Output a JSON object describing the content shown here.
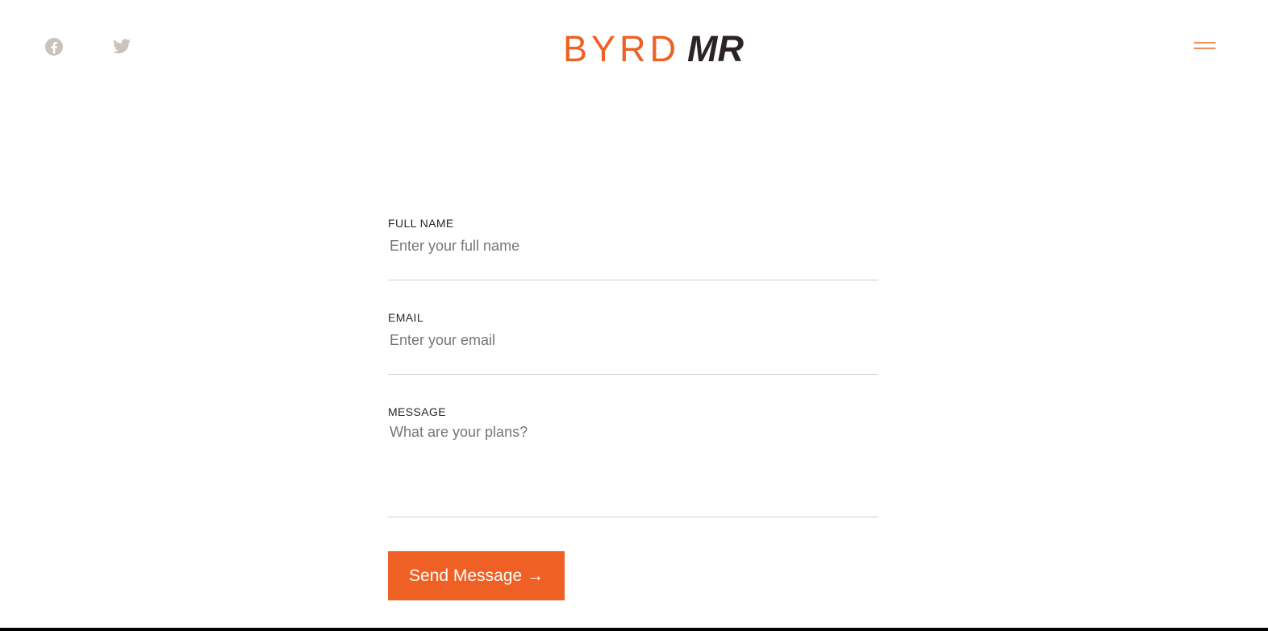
{
  "header": {
    "social": [
      {
        "icon": "facebook-icon",
        "color": "#c9c2bd"
      },
      {
        "icon": "twitter-icon",
        "color": "#c9c2bd"
      }
    ],
    "logo": {
      "part1": "BYRD",
      "part2": "MR",
      "part1_color": "#ee6023",
      "part2_color": "#2b2424"
    },
    "menu": {
      "icon": "hamburger-menu-icon",
      "color": "#ef8f59"
    }
  },
  "form": {
    "full_name": {
      "label": "FULL NAME",
      "placeholder": "Enter your full name",
      "value": ""
    },
    "email": {
      "label": "EMAIL",
      "placeholder": "Enter your email",
      "value": ""
    },
    "message": {
      "label": "MESSAGE",
      "placeholder": "What are your plans?",
      "value": ""
    },
    "submit_label": "Send Message →",
    "accent": "#ee6023"
  }
}
